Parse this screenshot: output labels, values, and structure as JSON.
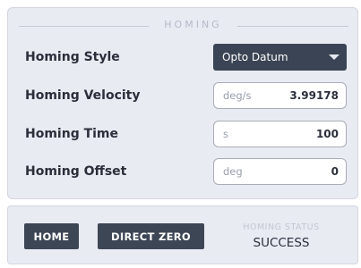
{
  "section": {
    "title": "HOMING"
  },
  "rows": {
    "style": {
      "label": "Homing Style",
      "value": "Opto Datum"
    },
    "velocity": {
      "label": "Homing Velocity",
      "unit": "deg/s",
      "value": "3.99178"
    },
    "time": {
      "label": "Homing Time",
      "unit": "s",
      "value": "100"
    },
    "offset": {
      "label": "Homing Offset",
      "unit": "deg",
      "value": "0"
    }
  },
  "footer": {
    "home_label": "HOME",
    "direct_zero_label": "DIRECT ZERO",
    "status_label": "HOMING STATUS",
    "status_value": "SUCCESS"
  },
  "icons": {
    "select_arrow": "chevron-down-icon"
  },
  "colors": {
    "panel_bg": "#e9ebf3",
    "button_bg": "#3d4655",
    "select_bg": "#3b4454",
    "text": "#2b2f3a"
  }
}
